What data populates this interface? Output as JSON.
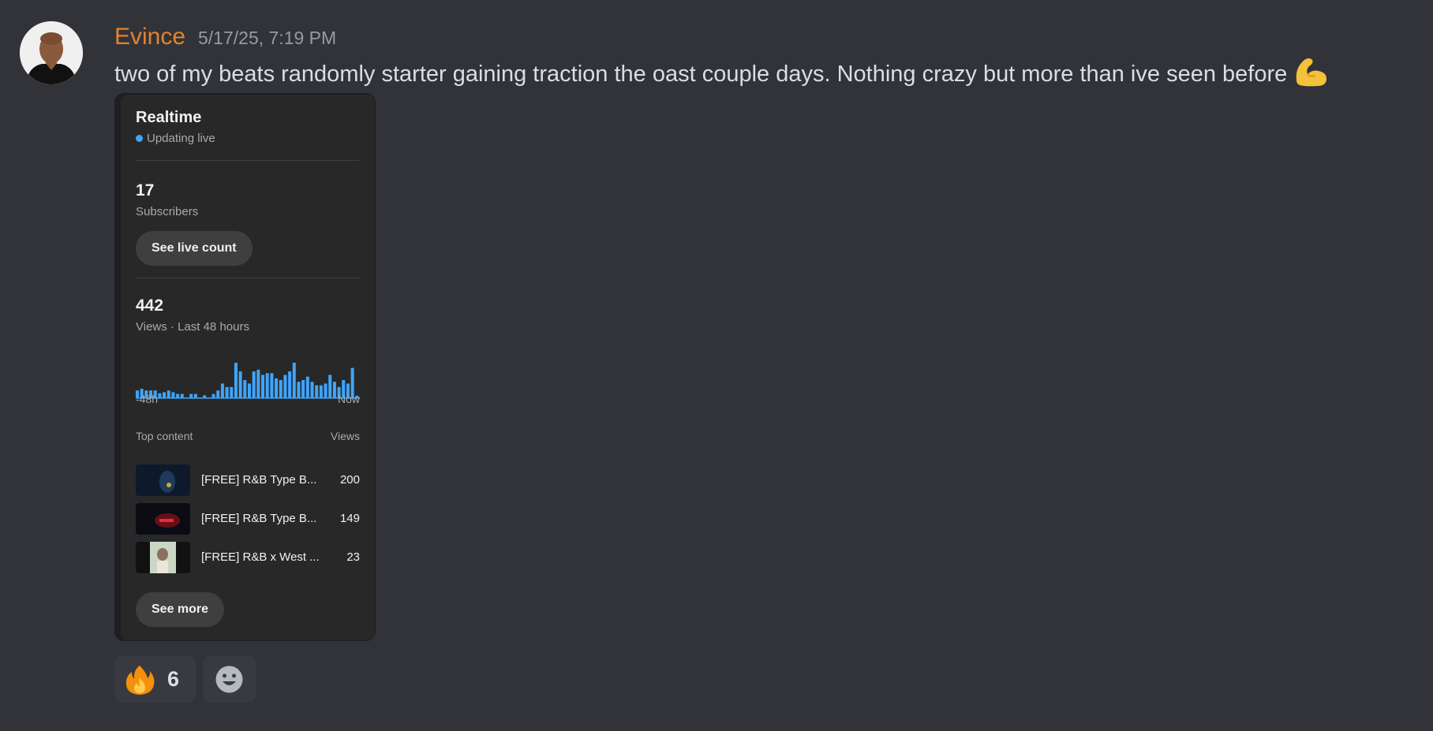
{
  "message": {
    "author": "Evince",
    "timestamp": "5/17/25, 7:19 PM",
    "text": "two of my beats randomly starter gaining traction the oast couple days. Nothing crazy but more than ive seen before",
    "emoji": "flexed-biceps"
  },
  "card": {
    "title": "Realtime",
    "live_label": "Updating live",
    "subscribers_count": "17",
    "subscribers_label": "Subscribers",
    "live_count_button": "See live count",
    "views_count": "442",
    "views_label": "Views · Last 48 hours",
    "axis_start": "-48h",
    "axis_end": "Now",
    "top_content_label": "Top content",
    "views_col_label": "Views",
    "top_content": [
      {
        "title": "[FREE] R&B Type B...",
        "views": "200"
      },
      {
        "title": "[FREE] R&B Type B...",
        "views": "149"
      },
      {
        "title": "[FREE] R&B x West ...",
        "views": "23"
      }
    ],
    "see_more_button": "See more",
    "colors": {
      "bar": "#3ea6ff",
      "live_dot": "#3ea6ff"
    }
  },
  "chart_data": {
    "type": "bar",
    "ylim": [
      0,
      10
    ],
    "values": [
      2,
      2.5,
      2,
      2,
      2,
      1.2,
      1.5,
      2,
      1.5,
      1,
      1,
      0,
      1,
      1,
      0,
      0.6,
      0,
      1,
      2,
      4,
      3,
      3,
      10,
      7.5,
      5,
      4,
      7.5,
      8,
      6.5,
      7,
      7,
      5.5,
      5,
      6.5,
      7.5,
      10,
      4.5,
      5,
      6,
      4.5,
      3.5,
      3.5,
      4,
      6.5,
      4.5,
      3,
      5,
      4,
      8.5,
      0.5
    ]
  },
  "reactions": [
    {
      "emoji": "fire",
      "count": "6"
    }
  ]
}
